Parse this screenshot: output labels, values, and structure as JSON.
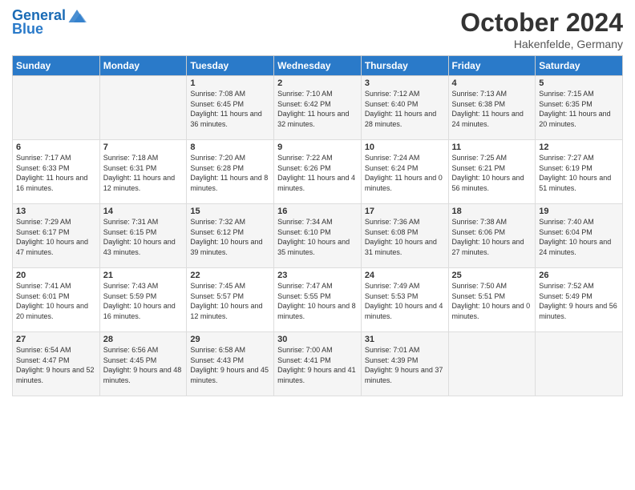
{
  "header": {
    "logo_line1": "General",
    "logo_line2": "Blue",
    "month": "October 2024",
    "location": "Hakenfelde, Germany"
  },
  "weekdays": [
    "Sunday",
    "Monday",
    "Tuesday",
    "Wednesday",
    "Thursday",
    "Friday",
    "Saturday"
  ],
  "weeks": [
    [
      {
        "day": "",
        "sunrise": "",
        "sunset": "",
        "daylight": ""
      },
      {
        "day": "",
        "sunrise": "",
        "sunset": "",
        "daylight": ""
      },
      {
        "day": "1",
        "sunrise": "Sunrise: 7:08 AM",
        "sunset": "Sunset: 6:45 PM",
        "daylight": "Daylight: 11 hours and 36 minutes."
      },
      {
        "day": "2",
        "sunrise": "Sunrise: 7:10 AM",
        "sunset": "Sunset: 6:42 PM",
        "daylight": "Daylight: 11 hours and 32 minutes."
      },
      {
        "day": "3",
        "sunrise": "Sunrise: 7:12 AM",
        "sunset": "Sunset: 6:40 PM",
        "daylight": "Daylight: 11 hours and 28 minutes."
      },
      {
        "day": "4",
        "sunrise": "Sunrise: 7:13 AM",
        "sunset": "Sunset: 6:38 PM",
        "daylight": "Daylight: 11 hours and 24 minutes."
      },
      {
        "day": "5",
        "sunrise": "Sunrise: 7:15 AM",
        "sunset": "Sunset: 6:35 PM",
        "daylight": "Daylight: 11 hours and 20 minutes."
      }
    ],
    [
      {
        "day": "6",
        "sunrise": "Sunrise: 7:17 AM",
        "sunset": "Sunset: 6:33 PM",
        "daylight": "Daylight: 11 hours and 16 minutes."
      },
      {
        "day": "7",
        "sunrise": "Sunrise: 7:18 AM",
        "sunset": "Sunset: 6:31 PM",
        "daylight": "Daylight: 11 hours and 12 minutes."
      },
      {
        "day": "8",
        "sunrise": "Sunrise: 7:20 AM",
        "sunset": "Sunset: 6:28 PM",
        "daylight": "Daylight: 11 hours and 8 minutes."
      },
      {
        "day": "9",
        "sunrise": "Sunrise: 7:22 AM",
        "sunset": "Sunset: 6:26 PM",
        "daylight": "Daylight: 11 hours and 4 minutes."
      },
      {
        "day": "10",
        "sunrise": "Sunrise: 7:24 AM",
        "sunset": "Sunset: 6:24 PM",
        "daylight": "Daylight: 11 hours and 0 minutes."
      },
      {
        "day": "11",
        "sunrise": "Sunrise: 7:25 AM",
        "sunset": "Sunset: 6:21 PM",
        "daylight": "Daylight: 10 hours and 56 minutes."
      },
      {
        "day": "12",
        "sunrise": "Sunrise: 7:27 AM",
        "sunset": "Sunset: 6:19 PM",
        "daylight": "Daylight: 10 hours and 51 minutes."
      }
    ],
    [
      {
        "day": "13",
        "sunrise": "Sunrise: 7:29 AM",
        "sunset": "Sunset: 6:17 PM",
        "daylight": "Daylight: 10 hours and 47 minutes."
      },
      {
        "day": "14",
        "sunrise": "Sunrise: 7:31 AM",
        "sunset": "Sunset: 6:15 PM",
        "daylight": "Daylight: 10 hours and 43 minutes."
      },
      {
        "day": "15",
        "sunrise": "Sunrise: 7:32 AM",
        "sunset": "Sunset: 6:12 PM",
        "daylight": "Daylight: 10 hours and 39 minutes."
      },
      {
        "day": "16",
        "sunrise": "Sunrise: 7:34 AM",
        "sunset": "Sunset: 6:10 PM",
        "daylight": "Daylight: 10 hours and 35 minutes."
      },
      {
        "day": "17",
        "sunrise": "Sunrise: 7:36 AM",
        "sunset": "Sunset: 6:08 PM",
        "daylight": "Daylight: 10 hours and 31 minutes."
      },
      {
        "day": "18",
        "sunrise": "Sunrise: 7:38 AM",
        "sunset": "Sunset: 6:06 PM",
        "daylight": "Daylight: 10 hours and 27 minutes."
      },
      {
        "day": "19",
        "sunrise": "Sunrise: 7:40 AM",
        "sunset": "Sunset: 6:04 PM",
        "daylight": "Daylight: 10 hours and 24 minutes."
      }
    ],
    [
      {
        "day": "20",
        "sunrise": "Sunrise: 7:41 AM",
        "sunset": "Sunset: 6:01 PM",
        "daylight": "Daylight: 10 hours and 20 minutes."
      },
      {
        "day": "21",
        "sunrise": "Sunrise: 7:43 AM",
        "sunset": "Sunset: 5:59 PM",
        "daylight": "Daylight: 10 hours and 16 minutes."
      },
      {
        "day": "22",
        "sunrise": "Sunrise: 7:45 AM",
        "sunset": "Sunset: 5:57 PM",
        "daylight": "Daylight: 10 hours and 12 minutes."
      },
      {
        "day": "23",
        "sunrise": "Sunrise: 7:47 AM",
        "sunset": "Sunset: 5:55 PM",
        "daylight": "Daylight: 10 hours and 8 minutes."
      },
      {
        "day": "24",
        "sunrise": "Sunrise: 7:49 AM",
        "sunset": "Sunset: 5:53 PM",
        "daylight": "Daylight: 10 hours and 4 minutes."
      },
      {
        "day": "25",
        "sunrise": "Sunrise: 7:50 AM",
        "sunset": "Sunset: 5:51 PM",
        "daylight": "Daylight: 10 hours and 0 minutes."
      },
      {
        "day": "26",
        "sunrise": "Sunrise: 7:52 AM",
        "sunset": "Sunset: 5:49 PM",
        "daylight": "Daylight: 9 hours and 56 minutes."
      }
    ],
    [
      {
        "day": "27",
        "sunrise": "Sunrise: 6:54 AM",
        "sunset": "Sunset: 4:47 PM",
        "daylight": "Daylight: 9 hours and 52 minutes."
      },
      {
        "day": "28",
        "sunrise": "Sunrise: 6:56 AM",
        "sunset": "Sunset: 4:45 PM",
        "daylight": "Daylight: 9 hours and 48 minutes."
      },
      {
        "day": "29",
        "sunrise": "Sunrise: 6:58 AM",
        "sunset": "Sunset: 4:43 PM",
        "daylight": "Daylight: 9 hours and 45 minutes."
      },
      {
        "day": "30",
        "sunrise": "Sunrise: 7:00 AM",
        "sunset": "Sunset: 4:41 PM",
        "daylight": "Daylight: 9 hours and 41 minutes."
      },
      {
        "day": "31",
        "sunrise": "Sunrise: 7:01 AM",
        "sunset": "Sunset: 4:39 PM",
        "daylight": "Daylight: 9 hours and 37 minutes."
      },
      {
        "day": "",
        "sunrise": "",
        "sunset": "",
        "daylight": ""
      },
      {
        "day": "",
        "sunrise": "",
        "sunset": "",
        "daylight": ""
      }
    ]
  ]
}
